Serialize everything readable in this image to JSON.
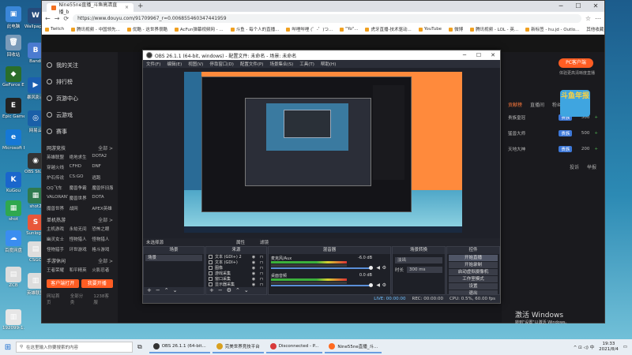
{
  "desktop_icons": [
    {
      "label": "此电脑",
      "color": "#3a86d8",
      "glyph": "▣"
    },
    {
      "label": "回收站",
      "color": "#7a9ab8",
      "glyph": "🗑"
    },
    {
      "label": "GeForce Experience",
      "color": "#2a6e2a",
      "glyph": "◆"
    },
    {
      "label": "Epic Games Launcher",
      "color": "#222222",
      "glyph": "E"
    },
    {
      "label": "Microsoft Edge",
      "color": "#1678d6",
      "glyph": "e"
    },
    {
      "label": "KuGou",
      "color": "#1a66cc",
      "glyph": "K"
    },
    {
      "label": "shot",
      "color": "#2fa84f",
      "glyph": "▦"
    },
    {
      "label": "百度网盘",
      "color": "#3a8df0",
      "glyph": "☁"
    },
    {
      "label": "ZCB",
      "color": "#dddddd",
      "glyph": "▤"
    },
    {
      "label": "192099-1...",
      "color": "#e6e6e6",
      "glyph": "▥"
    },
    {
      "label": "Wallpaper Engine",
      "color": "#264a7a",
      "glyph": "W"
    },
    {
      "label": "Bandi",
      "color": "#4b7bd0",
      "glyph": "B"
    },
    {
      "label": "暴风影音",
      "color": "#1b5fb0",
      "glyph": "▶"
    },
    {
      "label": "网易云",
      "color": "#1a5fa8",
      "glyph": "◎"
    },
    {
      "label": "OBS Studio",
      "color": "#333333",
      "glyph": "◉"
    },
    {
      "label": "shot2",
      "color": "#2f7a4f",
      "glyph": "▦"
    },
    {
      "label": "Sunlogin",
      "color": "#e8573a",
      "glyph": "S"
    },
    {
      "label": "CSGO",
      "color": "#dddddd",
      "glyph": "▤"
    },
    {
      "label": "英雄联盟",
      "color": "#dddddd",
      "glyph": "▥"
    }
  ],
  "browser": {
    "tab_title": "Nine55ne直播_斗鱼高清直播_b",
    "tab_close": "×",
    "new_tab": "+",
    "url": "https://www.douyu.com/91709967_r=0.006855460347441959",
    "nav_back": "←",
    "nav_forward": "→",
    "nav_reload": "⟳",
    "window_min": "─",
    "window_max": "☐",
    "window_close": "✕",
    "bookmarks": [
      "Twitch",
      "腾讯视频 - 中国领先...",
      "优酷 - 这世界很酷",
      "AcFun弹幕视频网 - ...",
      "斗鱼 - 每个人的直播...",
      "哔哩哔哩 (゜-゜)つ...",
      "\"Yo\"...",
      "虎牙直播-技术驱动...",
      "YouTube",
      "微博",
      "腾讯视频 - LOL - 英...",
      "新标签 - hu.jd - Outlo..."
    ],
    "bookmarks_other": "其他收藏夹"
  },
  "douyu": {
    "nav": [
      "我的关注",
      "排行榜",
      "页游中心",
      "云游戏",
      "赛事"
    ],
    "section_title": "网游竞技",
    "section_more": "全部 >",
    "games": [
      "英雄联盟",
      "绝地求生",
      "DOTA2",
      "穿越火线",
      "CFHD",
      "DNF",
      "炉石传说",
      "CS:GO",
      "逃跑",
      "QQ飞车",
      "魔兽争霸",
      "魔兽怀旧服",
      "VALORANT",
      "魔兽世界",
      "DOTA",
      "魔兽世界",
      "战网",
      "APEX英雄"
    ],
    "section2_title": "单机热游",
    "section2_more": "全部 >",
    "games2": [
      "主机游戏",
      "永劫无间",
      "恐怖之眼",
      "幽灵女士",
      "怪物猎人",
      "怪物猎人",
      "怪物猎手",
      "环世游戏",
      "格斗游戏"
    ],
    "section3_title": "手游休闲",
    "section3_more": "全部 >",
    "games3": [
      "王者荣耀",
      "和平精英",
      "火影忍者"
    ],
    "btn_client": "客户端打开",
    "btn_live": "我要开播",
    "footer": [
      "网站首页",
      "全部分类",
      "1238客服"
    ],
    "pc_button": "PC客户端",
    "pc_sub": "体验更高清晰度直播",
    "right_tabs": [
      "贡献榜",
      "直播间",
      "粉丝团"
    ],
    "rank_rows": [
      {
        "name": "贵族皇冠",
        "tag": "贵族",
        "value": "500"
      },
      {
        "name": "猛兽大师",
        "tag": "贵族",
        "value": "500"
      },
      {
        "name": "天地大神",
        "tag": "贵族",
        "value": "200"
      }
    ],
    "badge_text": "斗鱼年报",
    "right_actions": [
      "投诉",
      "举报"
    ]
  },
  "obs": {
    "title": "OBS 26.1.1 (64-bit, windows) - 配置文件: 未命名 - 场景: 未命名",
    "menu": [
      "文件(F)",
      "编辑(E)",
      "视图(V)",
      "停靠窗口(D)",
      "配置文件(P)",
      "场景集合(S)",
      "工具(T)",
      "帮助(H)"
    ],
    "min": "─",
    "max": "☐",
    "close": "✕",
    "no_source_label": "未选择源",
    "props_btn": "属性",
    "filters_btn": "滤镜",
    "dock_scenes": "场景",
    "dock_sources": "来源",
    "dock_mixer": "混音器",
    "dock_transitions": "场景转换",
    "dock_controls": "控件",
    "scenes": [
      "场景"
    ],
    "sources": [
      {
        "name": "文本 (GDI+) 2"
      },
      {
        "name": "文本 (GDI+)"
      },
      {
        "name": "图像"
      },
      {
        "name": "游戏采集"
      },
      {
        "name": "窗口采集"
      },
      {
        "name": "显示器采集"
      }
    ],
    "mixer": [
      {
        "name": "麦克风/Aux",
        "db": "-6.0 dB"
      },
      {
        "name": "桌面音频",
        "db": "0.0 dB"
      }
    ],
    "transition_select": "淡出",
    "duration_label": "时长",
    "duration_value": "300 ms",
    "controls": [
      "开始直播",
      "开始录制",
      "启动虚拟摄像机",
      "工作室模式",
      "设置",
      "退出"
    ],
    "status": {
      "live": "LIVE: 00:00:00",
      "rec": "REC: 00:00:00",
      "cpu": "CPU: 0.5%, 60.00 fps"
    }
  },
  "watermark": {
    "title": "激活 Windows",
    "sub": "转到\"设置\"以激活 Windows。"
  },
  "taskbar": {
    "search_placeholder": "在这里输入你要搜索的内容",
    "apps": [
      {
        "label": "OBS 26.1.1 (64-bit...",
        "color": "#333333"
      },
      {
        "label": "完美世界竞技平台",
        "color": "#d8a020"
      },
      {
        "label": "Disconnected - P...",
        "color": "#d83a3a"
      },
      {
        "label": "Nine55ne直播_斗...",
        "color": "#ff6a20"
      }
    ],
    "time": "19:33",
    "date": "2021/8/4",
    "tray_icons": "^ ⊡ ◁) 中"
  }
}
